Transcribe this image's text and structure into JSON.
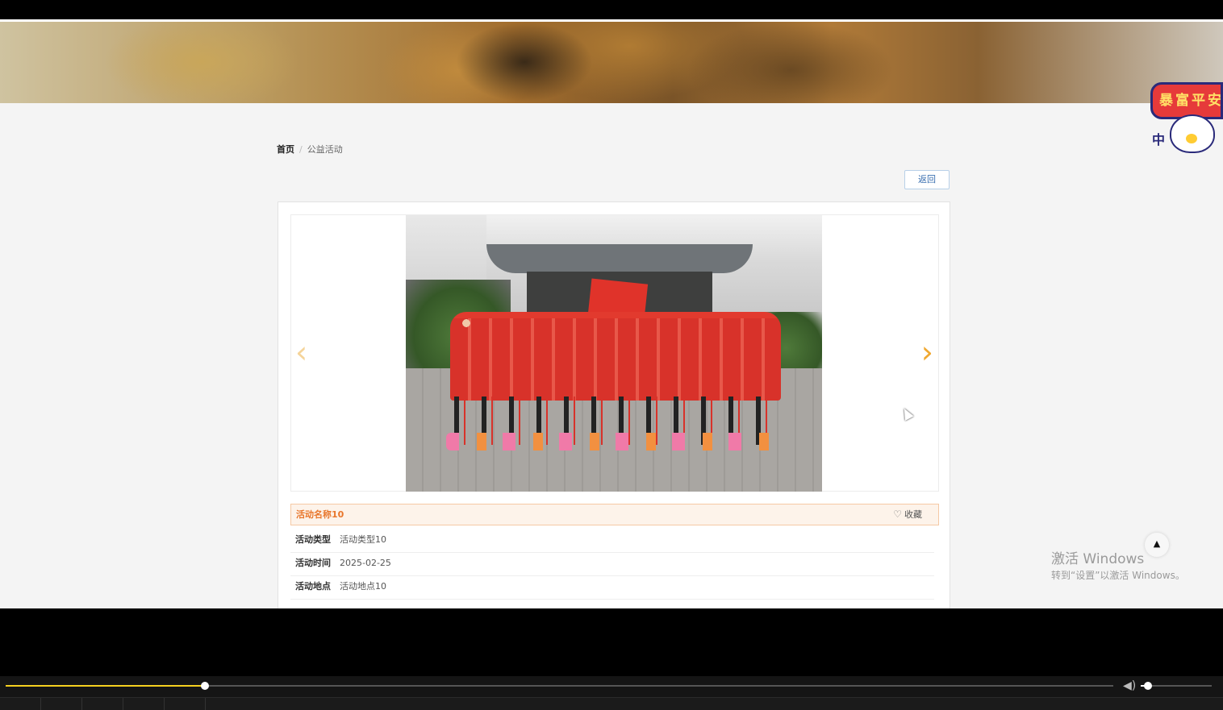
{
  "breadcrumb": {
    "home": "首页",
    "separator": "/",
    "current": "公益活动"
  },
  "back_button": {
    "label": "返回"
  },
  "carousel": {
    "prev_icon": "chevron-left-icon",
    "next_icon": "chevron-right-icon",
    "prev_glyph": "‹",
    "next_glyph": "›"
  },
  "activity": {
    "name": "活动名称10",
    "favorite_label": "收藏",
    "favorite_icon": "heart-icon",
    "fields": [
      {
        "label": "活动类型",
        "value": "活动类型10"
      },
      {
        "label": "活动时间",
        "value": "2025-02-25"
      },
      {
        "label": "活动地点",
        "value": "活动地点10"
      }
    ]
  },
  "sticker": {
    "text": "暴富平安",
    "plus": "中"
  },
  "back_to_top": {
    "glyph": "▲"
  },
  "watermark": {
    "line1": "激活 Windows",
    "line2": "转到“设置”以激活 Windows。"
  },
  "player": {
    "progress_percent": 18,
    "volume_percent": 10,
    "volume_glyph": "◀)"
  },
  "colors": {
    "accent": "#e8762b",
    "link": "#3a6fb0",
    "progress": "#f5d020"
  }
}
